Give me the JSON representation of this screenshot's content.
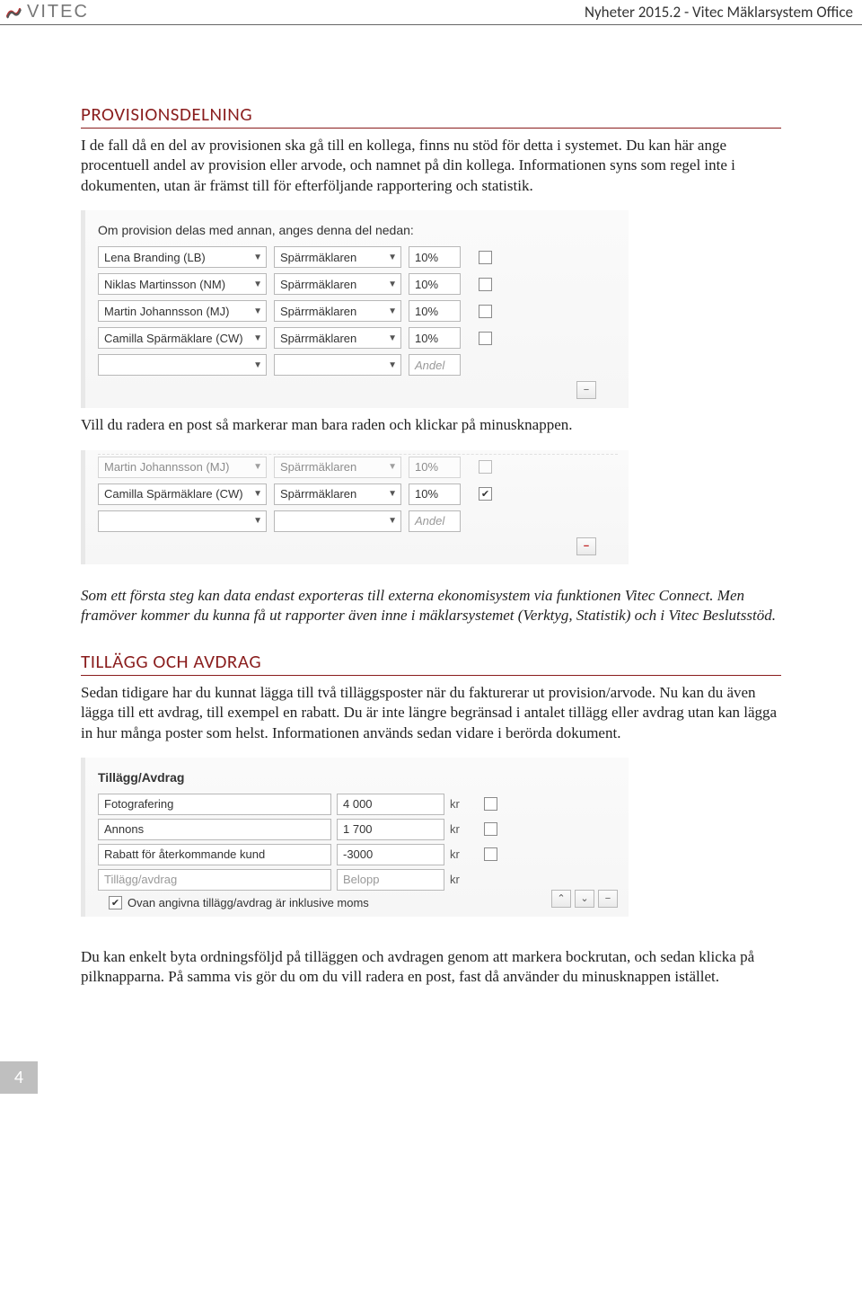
{
  "header": {
    "logo_text": "VITEC",
    "doc_title": "Nyheter 2015.2 - Vitec Mäklarsystem Office"
  },
  "section1": {
    "heading": "PROVISIONSDELNING",
    "para": "I de fall då en del av provisionen ska gå till en kollega, finns nu stöd för detta i systemet. Du kan här ange procentuell andel av provision eller arvode, och namnet på din kollega. Informationen syns som regel inte i dokumenten, utan är främst till för efterföljande rapportering och statistik."
  },
  "panel1": {
    "title": "Om provision delas med annan, anges denna del nedan:",
    "rows": [
      {
        "name": "Lena Branding (LB)",
        "role": "Spärrmäklaren",
        "pct": "10%",
        "checked": false
      },
      {
        "name": "Niklas Martinsson (NM)",
        "role": "Spärrmäklaren",
        "pct": "10%",
        "checked": false
      },
      {
        "name": "Martin Johannsson (MJ)",
        "role": "Spärrmäklaren",
        "pct": "10%",
        "checked": false
      },
      {
        "name": "Camilla Spärmäklare (CW)",
        "role": "Spärrmäklaren",
        "pct": "10%",
        "checked": false
      }
    ],
    "empty_row_pct_placeholder": "Andel",
    "minus_label": "−"
  },
  "mid_text": "Vill du radera en post så markerar man bara raden och klickar på minusknappen.",
  "panel2": {
    "rows": [
      {
        "name": "Martin Johannsson (MJ)",
        "role": "Spärrmäklaren",
        "pct": "10%",
        "checked": false,
        "faded": true
      },
      {
        "name": "Camilla Spärmäklare (CW)",
        "role": "Spärrmäklaren",
        "pct": "10%",
        "checked": true,
        "faded": false
      }
    ],
    "empty_row_pct_placeholder": "Andel"
  },
  "italic_note": "Som ett första steg kan data endast exporteras till externa ekonomisystem via funktionen Vitec Connect. Men framöver kommer du kunna få ut rapporter även inne i mäklarsystemet (Verktyg, Statistik) och i Vitec Beslutsstöd.",
  "section2": {
    "heading": "TILLÄGG OCH AVDRAG",
    "para": "Sedan tidigare har du kunnat lägga till två tilläggsposter när du fakturerar ut provision/arvode. Nu kan du även lägga till ett avdrag, till exempel en rabatt. Du är inte längre begränsad i antalet tillägg eller avdrag utan kan lägga in hur många poster som helst. Informationen används sedan vidare i berörda dokument."
  },
  "panel3": {
    "title": "Tillägg/Avdrag",
    "rows": [
      {
        "name": "Fotografering",
        "amount": "4 000",
        "unit": "kr"
      },
      {
        "name": "Annons",
        "amount": "1 700",
        "unit": "kr"
      },
      {
        "name": "Rabatt för återkommande kund",
        "amount": "-3000",
        "unit": "kr"
      }
    ],
    "empty_name_placeholder": "Tillägg/avdrag",
    "empty_amount_placeholder": "Belopp",
    "empty_unit": "kr",
    "moms_checked": true,
    "moms_label": "Ovan angivna tillägg/avdrag är inklusive moms"
  },
  "closing_para": "Du kan enkelt byta ordningsföljd på tilläggen och avdragen genom att markera bockrutan, och sedan klicka på pilknapparna. På samma vis gör du om du vill radera en post, fast då använder du minusknappen istället.",
  "page_number": "4"
}
